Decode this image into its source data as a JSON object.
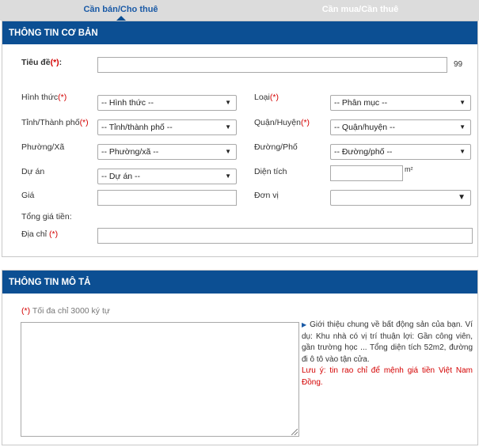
{
  "tabs": [
    {
      "label": "Cần bán/Cho thuê",
      "active": true
    },
    {
      "label": "Cần mua/Cần thuê",
      "active": false
    }
  ],
  "section_basic": {
    "title": "THÔNG TIN CƠ BẢN",
    "title_field": {
      "label": "Tiêu đề",
      "required_mark": "(*)",
      "colon": ":",
      "value": "",
      "counter": "99"
    },
    "type_field": {
      "label": "Hình thức",
      "required_mark": "(*)",
      "selected": "-- Hình thức --"
    },
    "category_field": {
      "label": "Loại",
      "required_mark": "(*)",
      "selected": "-- Phân mục --"
    },
    "province_field": {
      "label": "Tỉnh/Thành phố",
      "required_mark": "(*)",
      "selected": "-- Tỉnh/thành phố --"
    },
    "district_field": {
      "label": "Quận/Huyện",
      "required_mark": "(*)",
      "selected": "-- Quận/huyện --"
    },
    "ward_field": {
      "label": "Phường/Xã",
      "selected": "-- Phường/xã --"
    },
    "street_field": {
      "label": "Đường/Phố",
      "selected": "-- Đường/phố --"
    },
    "project_field": {
      "label": "Dự án",
      "selected": "-- Dự án --"
    },
    "area_field": {
      "label": "Diện tích",
      "value": "",
      "unit": "m²"
    },
    "price_field": {
      "label": "Giá",
      "value": ""
    },
    "price_unit_field": {
      "label": "Đơn vị",
      "selected": ""
    },
    "total_price": {
      "label": "Tổng giá tiền:"
    },
    "address_field": {
      "label": "Địa chỉ",
      "required_mark": "(*)",
      "value": ""
    }
  },
  "section_desc": {
    "title": "THÔNG TIN MÔ TẢ",
    "required_mark": "(*)",
    "limit_note": "Tối đa chỉ 3000 ký tự",
    "description_value": "",
    "hint_text": "Giới thiệu chung về bất động sản của bạn. Ví dụ: Khu nhà có vị trí thuận lợi: Gần công viên, gần trường học ... Tổng diện tích 52m2, đường đi ô tô vào tận cửa.",
    "warning_text": "Lưu ý: tin rao chỉ để mệnh giá tiền Việt Nam Đồng."
  },
  "icons": {
    "select_arrow": "▼",
    "hint_bullet": "▶"
  },
  "colors": {
    "header_bg": "#0c4f93",
    "active_tab_text": "#1a5aa6",
    "tab_bar_bg": "#dcdcdc",
    "required": "#d40000"
  }
}
